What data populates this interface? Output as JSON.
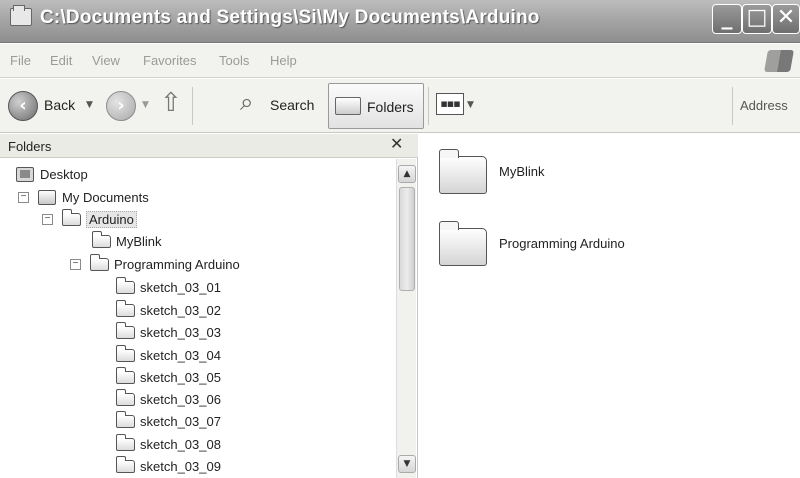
{
  "window": {
    "title": "C:\\Documents and Settings\\Si\\My Documents\\Arduino",
    "minimize_glyph": "_",
    "maximize_glyph": "□",
    "close_glyph": "✕"
  },
  "menu": [
    "File",
    "Edit",
    "View",
    "Favorites",
    "Tools",
    "Help"
  ],
  "toolbar": {
    "back_label": "Back",
    "search_label": "Search",
    "folders_label": "Folders",
    "address_label": "Address"
  },
  "folders_pane": {
    "title": "Folders",
    "close_glyph": "✕",
    "tree": [
      {
        "label": "Desktop",
        "icon": "desktop-icon",
        "level": 0,
        "expander": ""
      },
      {
        "label": "My Documents",
        "icon": "my-documents-icon",
        "level": 1,
        "expander": "−"
      },
      {
        "label": "Arduino",
        "icon": "folder-icon",
        "level": 2,
        "expander": "−",
        "selected": true
      },
      {
        "label": "MyBlink",
        "icon": "folder-icon",
        "level": 3,
        "expander": ""
      },
      {
        "label": "Programming Arduino",
        "icon": "folder-icon",
        "level": 3,
        "expander": "−"
      },
      {
        "label": "sketch_03_01",
        "icon": "folder-icon",
        "level": 4,
        "expander": ""
      },
      {
        "label": "sketch_03_02",
        "icon": "folder-icon",
        "level": 4,
        "expander": ""
      },
      {
        "label": "sketch_03_03",
        "icon": "folder-icon",
        "level": 4,
        "expander": ""
      },
      {
        "label": "sketch_03_04",
        "icon": "folder-icon",
        "level": 4,
        "expander": ""
      },
      {
        "label": "sketch_03_05",
        "icon": "folder-icon",
        "level": 4,
        "expander": ""
      },
      {
        "label": "sketch_03_06",
        "icon": "folder-icon",
        "level": 4,
        "expander": ""
      },
      {
        "label": "sketch_03_07",
        "icon": "folder-icon",
        "level": 4,
        "expander": ""
      },
      {
        "label": "sketch_03_08",
        "icon": "folder-icon",
        "level": 4,
        "expander": ""
      },
      {
        "label": "sketch_03_09",
        "icon": "folder-icon",
        "level": 4,
        "expander": ""
      }
    ]
  },
  "content": {
    "items": [
      {
        "label": "MyBlink",
        "icon": "folder-icon"
      },
      {
        "label": "Programming Arduino",
        "icon": "folder-icon"
      }
    ]
  }
}
